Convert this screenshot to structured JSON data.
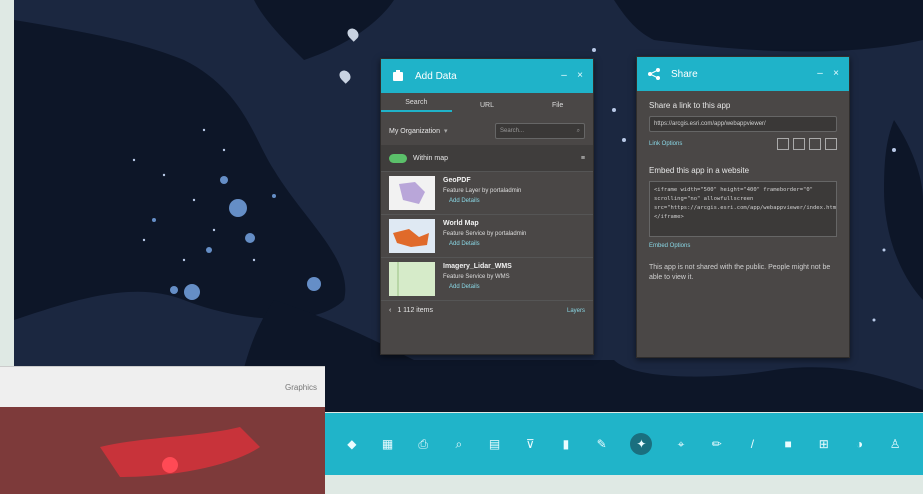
{
  "add_data_panel": {
    "title": "Add Data",
    "tabs": [
      "Search",
      "URL",
      "File"
    ],
    "org_label": "My Organization",
    "search_placeholder": "Search...",
    "toggle_label": "Within map",
    "items": [
      {
        "title": "GeoPDF",
        "desc": "Feature Layer by portaladmin",
        "action": "Add  Details"
      },
      {
        "title": "World Map",
        "desc": "Feature Service by portaladmin",
        "action": "Add  Details"
      },
      {
        "title": "Imagery_Lidar_WMS",
        "desc": "Feature Service by WMS",
        "action": "Add  Details"
      }
    ],
    "pager_text": "1   112 items",
    "layers_button": "Layers"
  },
  "share_panel": {
    "title": "Share",
    "link_heading": "Share a link to this app",
    "link_value": "https://arcgis.esri.com/app/webappviewer/",
    "link_options": "Link Options",
    "embed_heading": "Embed this app in a website",
    "embed_code": "<iframe width=\"500\" height=\"400\" frameborder=\"0\" scrolling=\"no\" allowfullscreen src=\"https://arcgis.esri.com/app/webappviewer/index.html\"></iframe>",
    "embed_options": "Embed Options",
    "note": "This app is not shared with the public. People might not be able to view it."
  },
  "toolbar": {
    "tools": [
      "layers-icon",
      "gallery-icon",
      "print-icon",
      "search-icon",
      "table-icon",
      "filter-icon",
      "chart-icon",
      "draw-icon",
      "share-icon",
      "measure-icon",
      "edit-icon",
      "pencil-icon",
      "select-icon",
      "grid-icon",
      "swipe-icon",
      "person-icon"
    ],
    "selected_index": 8
  },
  "inset": {
    "search_text": "Graphics"
  }
}
